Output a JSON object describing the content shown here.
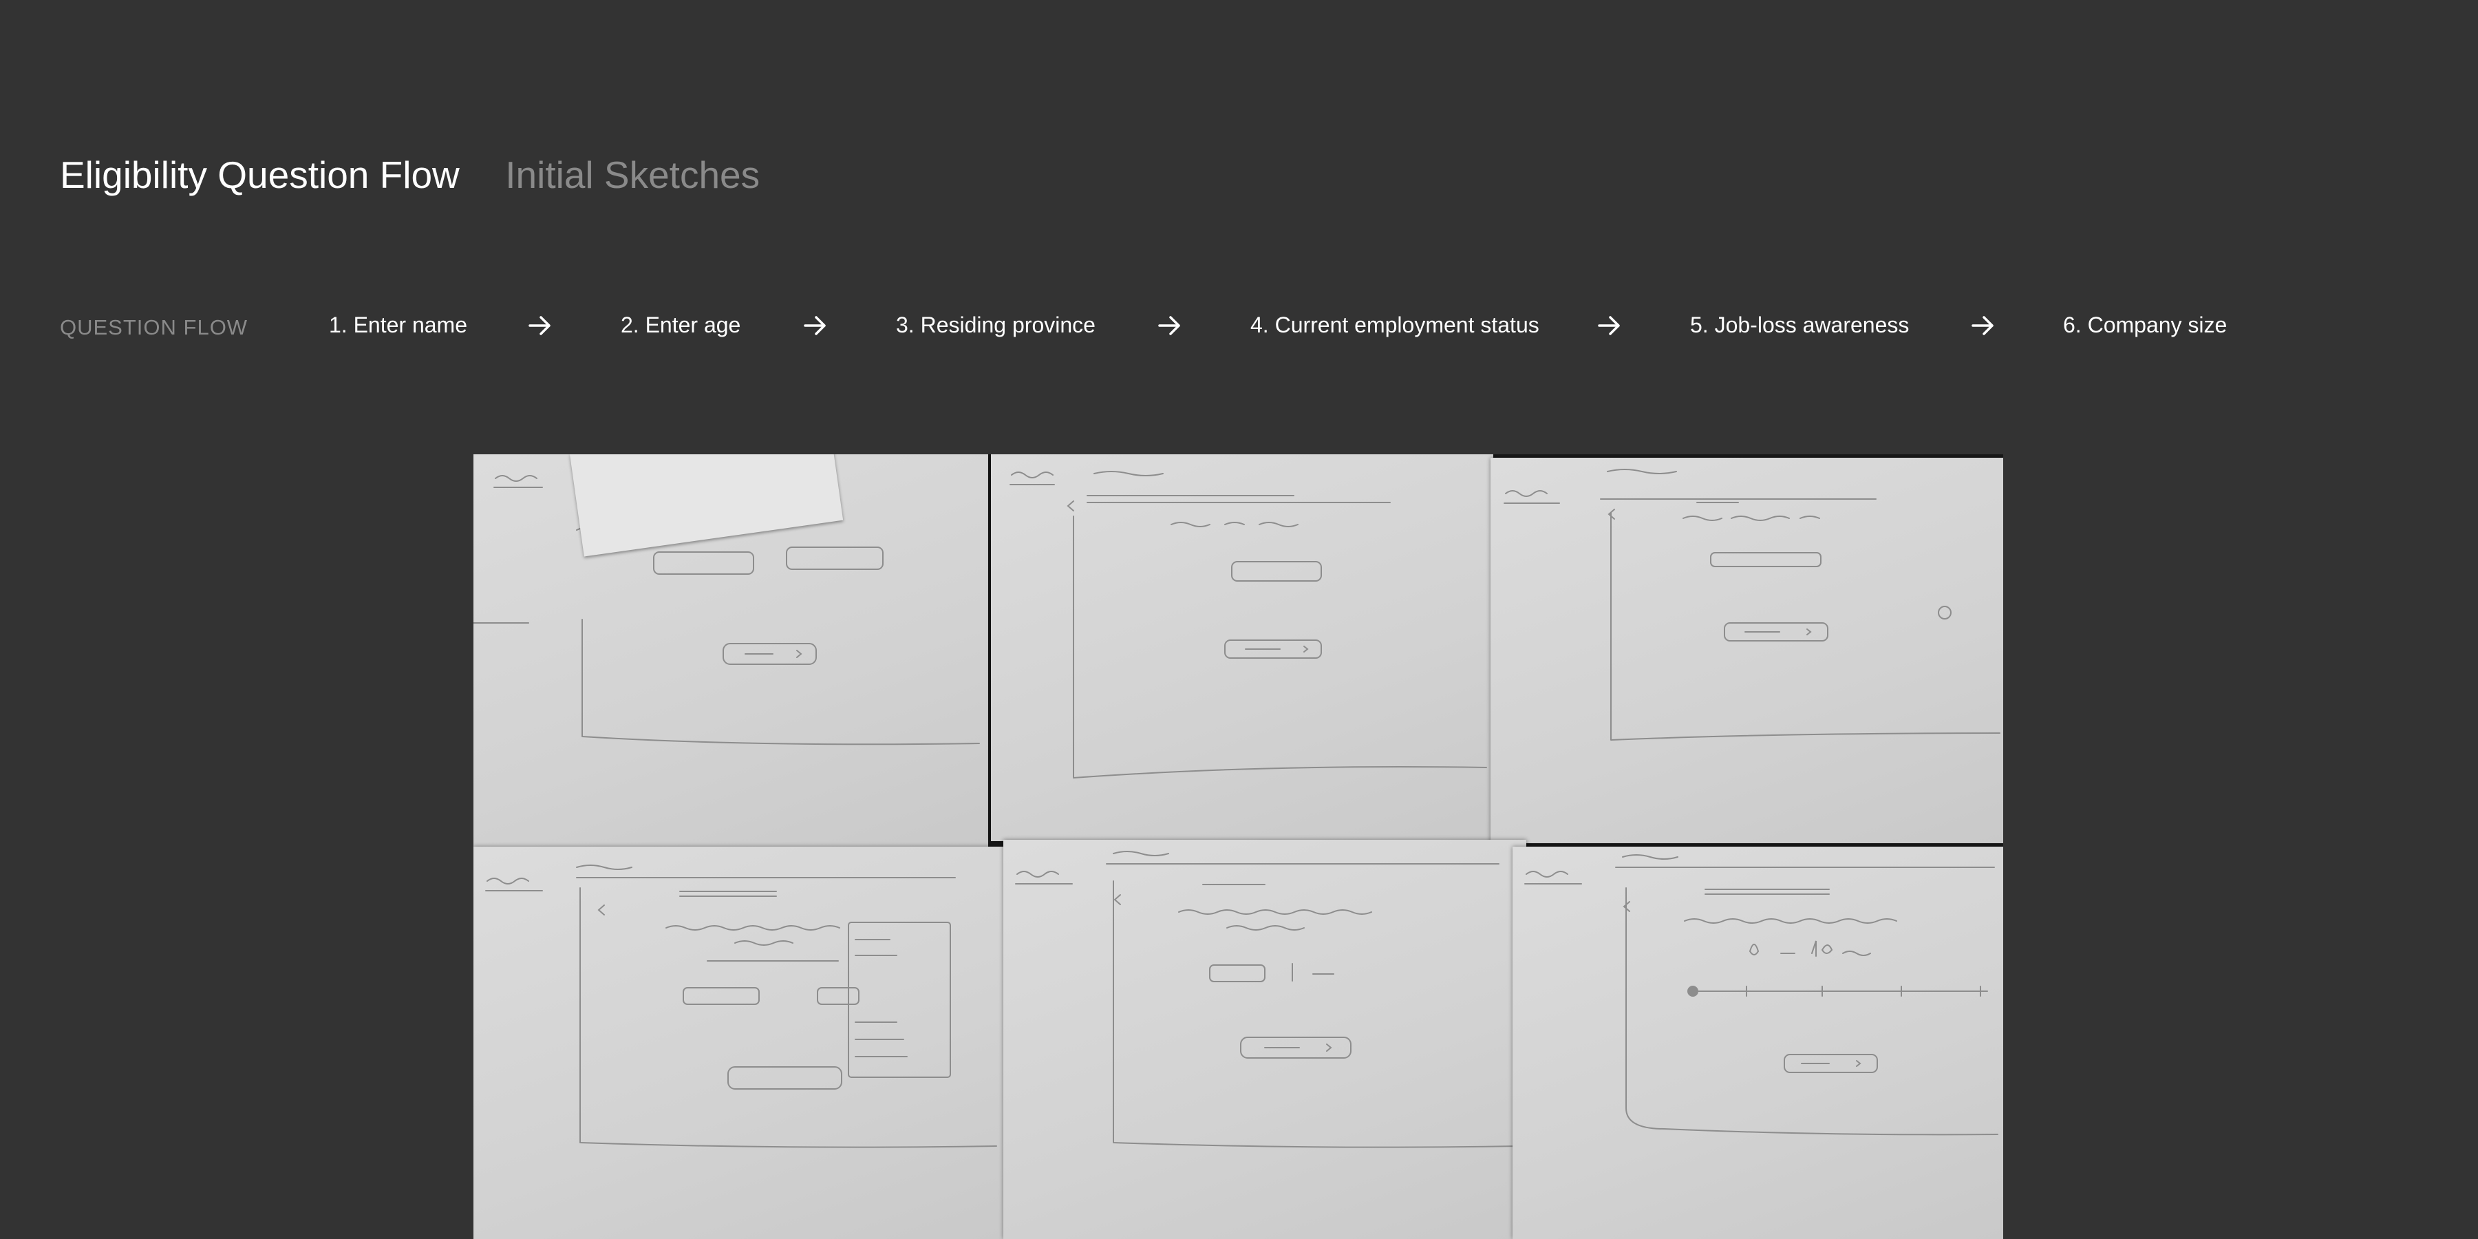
{
  "header": {
    "title": "Eligibility Question Flow",
    "subtitle": "Initial Sketches"
  },
  "flow": {
    "label": "QUESTION FLOW",
    "steps": [
      {
        "label": "1. Enter name"
      },
      {
        "label": "2. Enter age"
      },
      {
        "label": "3. Residing province"
      },
      {
        "label": "4. Current employment status"
      },
      {
        "label": "5. Job-loss awareness"
      },
      {
        "label": "6. Company size"
      }
    ],
    "arrow_icon": "arrow-right-icon"
  },
  "image": {
    "name": "initial-sketches-photo",
    "description_icon": "photo-of-paper-sketches"
  },
  "colors": {
    "background": "#333333",
    "title": "#ffffff",
    "muted": "#8a8a8a",
    "paper": "#d6d6d6"
  }
}
